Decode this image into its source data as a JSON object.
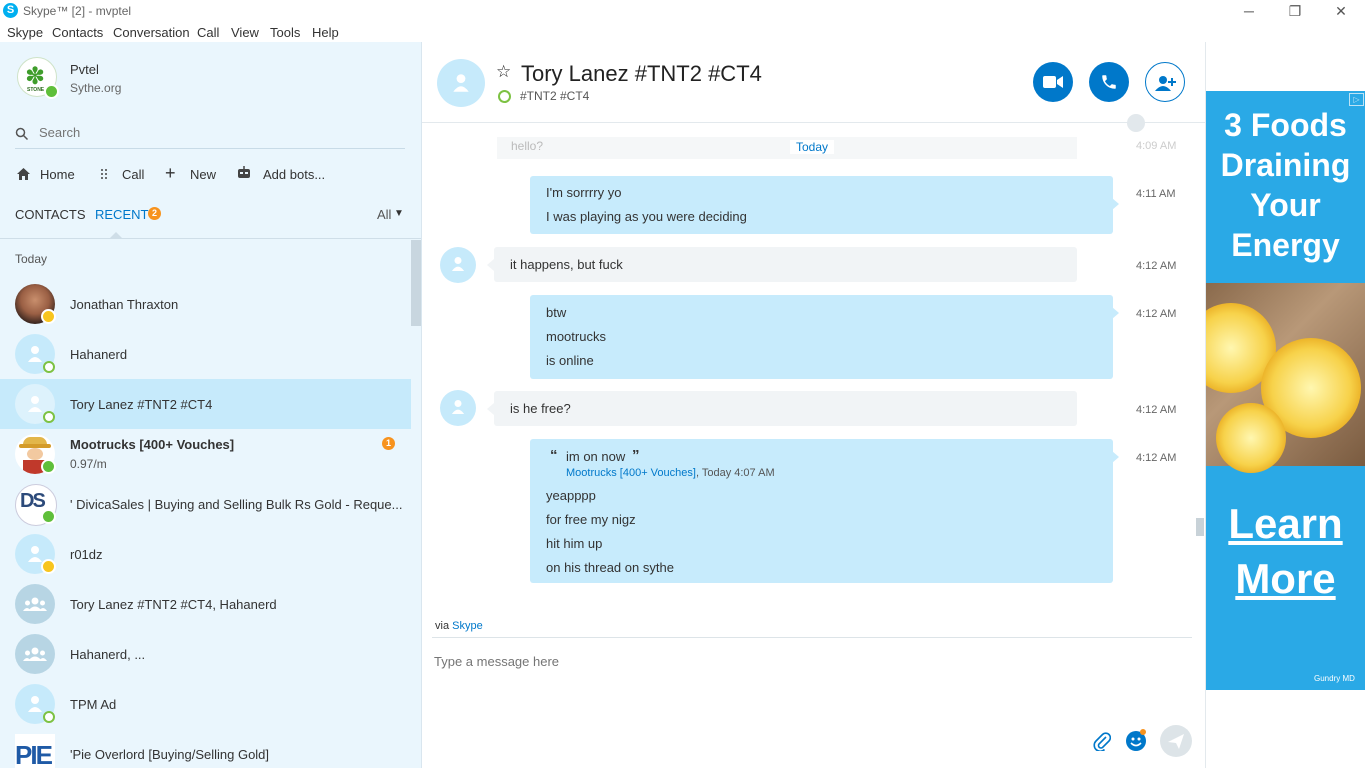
{
  "window": {
    "title": "Skype™ [2] - mvptel",
    "logo_letter": "S",
    "controls": {
      "minimize": "─",
      "restore": "❐",
      "close": "✕"
    }
  },
  "menu": [
    "Skype",
    "Contacts",
    "Conversation",
    "Call",
    "View",
    "Tools",
    "Help"
  ],
  "profile": {
    "name": "Pvtel",
    "subtitle": "Sythe.org",
    "avatar_text": "STONE"
  },
  "search": {
    "placeholder": "Search"
  },
  "nav": {
    "home": "Home",
    "call": "Call",
    "new": "New",
    "add_bots": "Add bots..."
  },
  "tabs": {
    "contacts": "CONTACTS",
    "recent": "RECENT",
    "recent_badge": "2",
    "filter": "All"
  },
  "section_today": "Today",
  "contacts": [
    {
      "name": "Jonathan Thraxton",
      "status": "away"
    },
    {
      "name": "Hahanerd",
      "status": "offline"
    },
    {
      "name": "Tory Lanez #TNT2 #CT4",
      "status": "offline",
      "selected": true
    },
    {
      "name": "Mootrucks [400+ Vouches]",
      "sub": "0.97/m",
      "status": "online",
      "unread": "1"
    },
    {
      "name": "' DivicaSales | Buying and Selling Bulk Rs Gold - Reque...",
      "status": "online",
      "avatar_text": "DS"
    },
    {
      "name": "r01dz",
      "status": "away"
    },
    {
      "name": "Tory Lanez #TNT2 #CT4, Hahanerd",
      "status": "group"
    },
    {
      "name": "Hahanerd, ...",
      "status": "group"
    },
    {
      "name": "TPM Ad",
      "status": "offline"
    },
    {
      "name": "'Pie Overlord [Buying/Selling Gold]",
      "status": "online",
      "avatar_text": "PIE"
    }
  ],
  "chat": {
    "title": "Tory Lanez #TNT2 #CT4",
    "mood": "#TNT2 #CT4",
    "date_divider": "Today",
    "faded_preview": "hello?",
    "faded_time": "4:09 AM",
    "messages": [
      {
        "dir": "out",
        "lines": [
          "I'm sorrrry yo",
          "I was playing as you were deciding"
        ],
        "time": "4:11 AM"
      },
      {
        "dir": "in",
        "lines": [
          "it happens, but fuck"
        ],
        "time": "4:12 AM"
      },
      {
        "dir": "out",
        "lines": [
          "btw",
          "mootrucks",
          "is online"
        ],
        "time": "4:12 AM"
      },
      {
        "dir": "in",
        "lines": [
          "is he free?"
        ],
        "time": "4:12 AM"
      },
      {
        "dir": "out",
        "quote": "im on now",
        "quote_author": "Mootrucks [400+ Vouches]",
        "quote_time": ", Today 4:07 AM",
        "lines": [
          "yeapppp",
          "for free my nigz",
          "hit him up",
          "on his thread on sythe"
        ],
        "time": "4:12 AM"
      }
    ],
    "via_prefix": "via",
    "via_link": "Skype",
    "compose_placeholder": "Type a message here"
  },
  "ad": {
    "title": "3 Foods Draining Your Energy",
    "cta": "Learn More",
    "sponsor": "Gundry MD"
  },
  "colors": {
    "accent": "#0078ca",
    "link": "#0078ca",
    "sidebar_bg": "#eaf6fd",
    "selected": "#c6eafb",
    "bubble_out": "#c7ebfc",
    "badge": "#f7931e"
  }
}
